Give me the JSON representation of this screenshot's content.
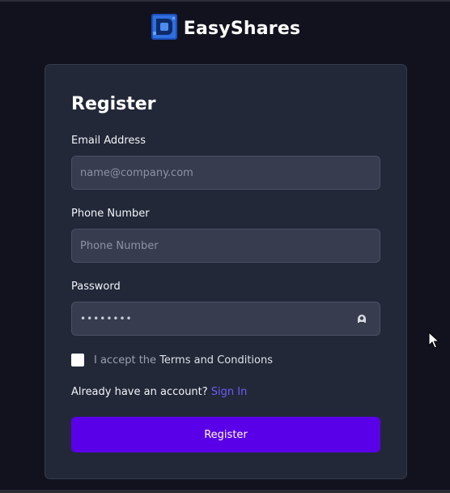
{
  "brand": {
    "name": "EasyShares",
    "logo_icon": "easyshares-logo-icon",
    "logo_color": "#2f6fde"
  },
  "form": {
    "title": "Register",
    "email": {
      "label": "Email Address",
      "placeholder": "name@company.com",
      "value": ""
    },
    "phone": {
      "label": "Phone Number",
      "placeholder": "Phone Number",
      "value": ""
    },
    "password": {
      "label": "Password",
      "masked_value": "••••••••",
      "toggle_icon": "eye-toggle-icon"
    },
    "terms": {
      "prefix": "I accept the ",
      "link": "Terms and Conditions",
      "checked": false
    },
    "signin": {
      "prompt": "Already have an account? ",
      "link": "Sign In"
    },
    "submit_label": "Register"
  },
  "colors": {
    "background": "#12121f",
    "card": "#222838",
    "accent_button": "#5a00e8",
    "link": "#6d5cf6"
  }
}
